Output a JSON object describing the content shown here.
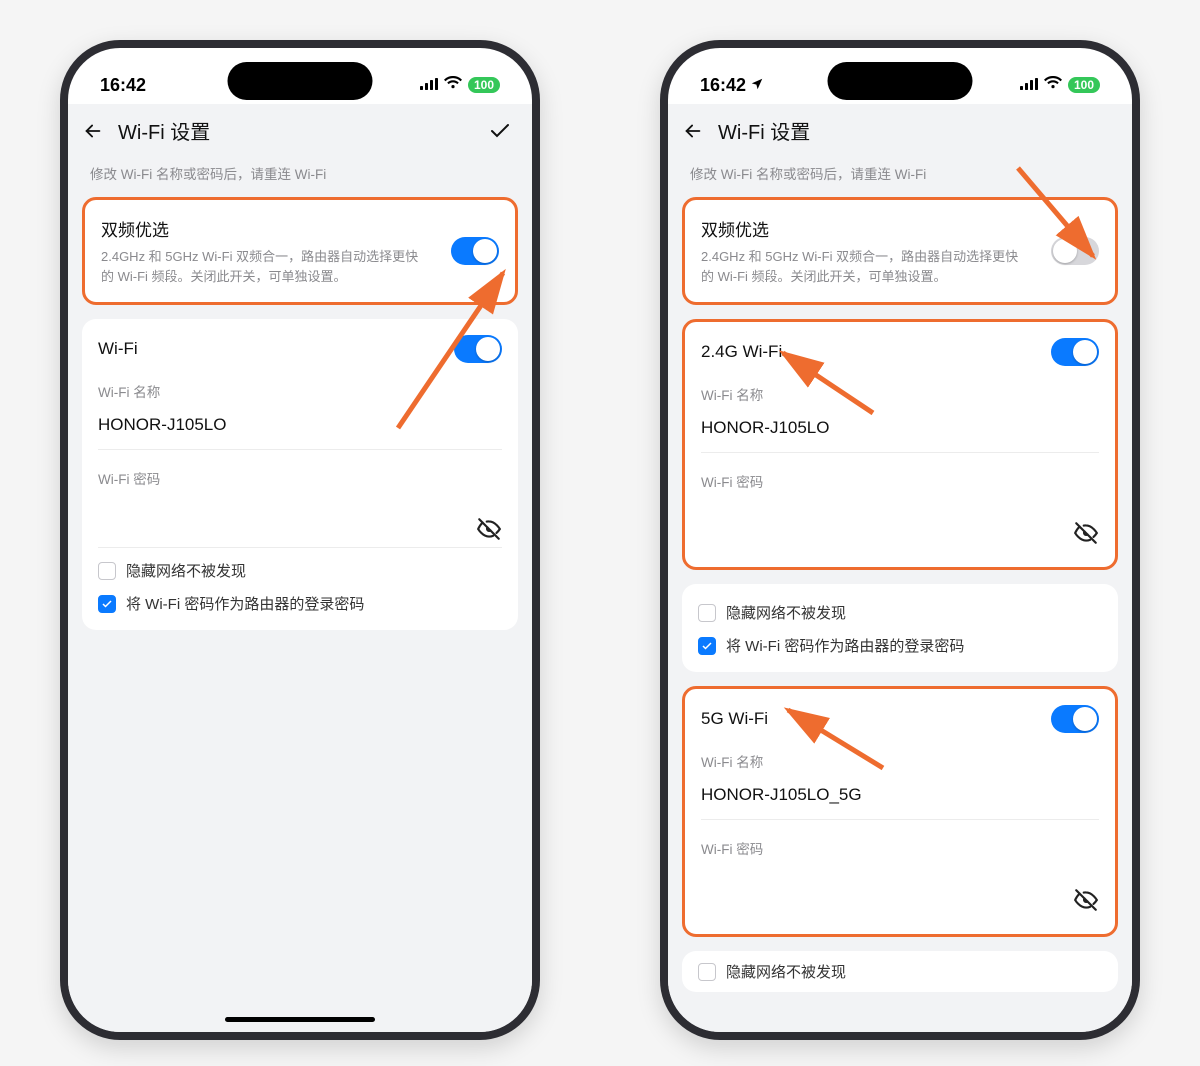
{
  "status": {
    "time": "16:42",
    "battery": "100"
  },
  "nav": {
    "title": "Wi-Fi 设置"
  },
  "notice": "修改 Wi-Fi 名称或密码后，请重连 Wi-Fi",
  "dualBand": {
    "title": "双频优选",
    "desc": "2.4GHz 和 5GHz Wi-Fi 双频合一，路由器自动选择更快的 Wi-Fi 频段。关闭此开关，可单独设置。"
  },
  "labels": {
    "wifiSingle": "Wi-Fi",
    "wifi24": "2.4G Wi-Fi",
    "wifi5g": "5G Wi-Fi",
    "nameLabel": "Wi-Fi 名称",
    "pwLabel": "Wi-Fi 密码",
    "hideSsid": "隐藏网络不被发现",
    "useWifiPwAsLogin": "将 Wi-Fi 密码作为路由器的登录密码"
  },
  "ssids": {
    "main": "HONOR-J105LO",
    "g5": "HONOR-J105LO_5G"
  }
}
